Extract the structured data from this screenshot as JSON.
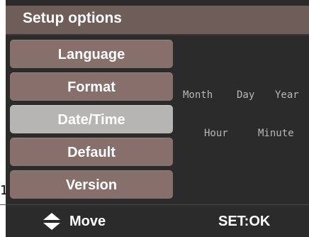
{
  "header": {
    "title": "Setup options"
  },
  "menu": {
    "items": [
      {
        "label": "Language",
        "selected": false
      },
      {
        "label": "Format",
        "selected": false
      },
      {
        "label": "Date/Time",
        "selected": true
      },
      {
        "label": "Default",
        "selected": false
      },
      {
        "label": "Version",
        "selected": false
      }
    ]
  },
  "detail": {
    "date_fields": [
      "Month",
      "Day",
      "Year"
    ],
    "time_fields": [
      "Hour",
      "Minute"
    ]
  },
  "footer": {
    "move_label": "Move",
    "move_icon": "up-down-arrow-icon",
    "ok_label": "SET:OK"
  },
  "stray": {
    "char": "1"
  },
  "colors": {
    "background": "#2c2b2b",
    "title_bar": "#6f5d5a",
    "menu_item": "#87706b",
    "menu_item_selected": "#b6b5b3",
    "detail_text": "#b8b8b8",
    "text": "#ffffff"
  }
}
